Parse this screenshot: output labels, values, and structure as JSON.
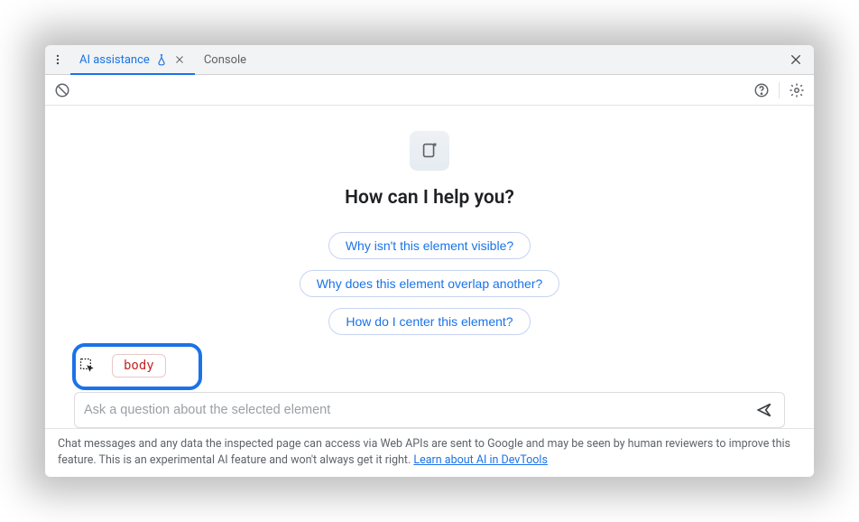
{
  "tabs": {
    "active": "AI assistance",
    "other": "Console"
  },
  "heading": "How can I help you?",
  "suggestions": [
    "Why isn't this element visible?",
    "Why does this element overlap another?",
    "How do I center this element?"
  ],
  "context": {
    "selected_element": "body"
  },
  "input": {
    "placeholder": "Ask a question about the selected element"
  },
  "footer": {
    "text": "Chat messages and any data the inspected page can access via Web APIs are sent to Google and may be seen by human reviewers to improve this feature. This is an experimental AI feature and won't always get it right. ",
    "link_label": "Learn about AI in DevTools"
  }
}
